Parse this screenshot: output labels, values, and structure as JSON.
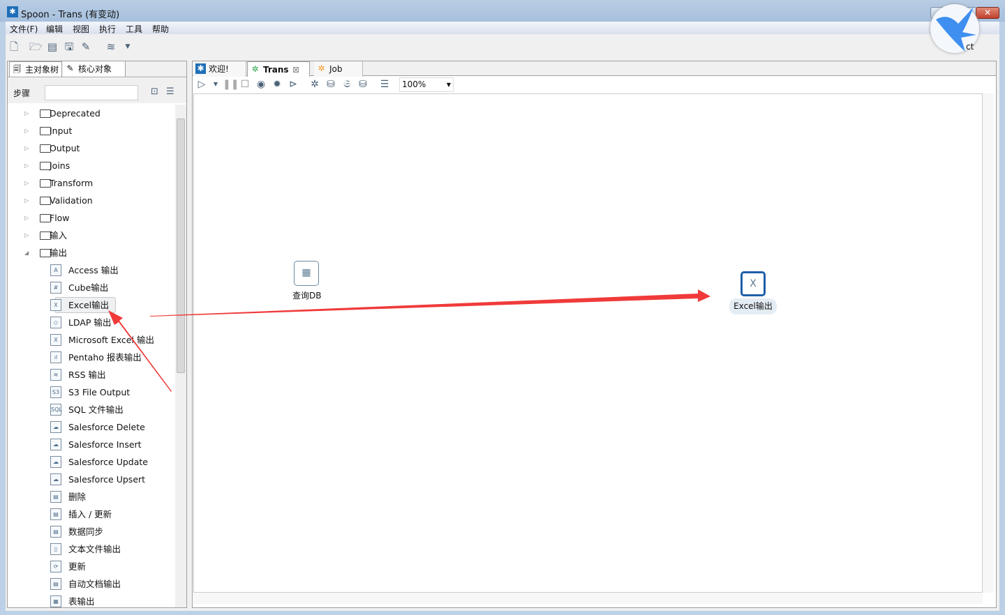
{
  "window": {
    "title": "Spoon - Trans (有变动)",
    "partial_label": "ct"
  },
  "menu": [
    "文件(F)",
    "编辑",
    "视图",
    "执行",
    "工具",
    "帮助"
  ],
  "left_panel": {
    "tabs": [
      "主对象树",
      "核心对象"
    ],
    "search_label": "步骤",
    "search_value": "",
    "folders": [
      "Deprecated",
      "Input",
      "Output",
      "Joins",
      "Transform",
      "Validation",
      "Flow",
      "输入"
    ],
    "expanded_folder": "输出",
    "steps": [
      {
        "label": "Access 输出",
        "icon": "A"
      },
      {
        "label": "Cube输出",
        "icon": "#"
      },
      {
        "label": "Excel输出",
        "icon": "X"
      },
      {
        "label": "LDAP 输出",
        "icon": "◇"
      },
      {
        "label": "Microsoft Excel 输出",
        "icon": "X"
      },
      {
        "label": "Pentaho 报表输出",
        "icon": "ıl"
      },
      {
        "label": "RSS 输出",
        "icon": "≋"
      },
      {
        "label": "S3 File Output",
        "icon": "S3"
      },
      {
        "label": "SQL 文件输出",
        "icon": "SQL"
      },
      {
        "label": "Salesforce Delete",
        "icon": "☁"
      },
      {
        "label": "Salesforce Insert",
        "icon": "☁"
      },
      {
        "label": "Salesforce Update",
        "icon": "☁"
      },
      {
        "label": "Salesforce Upsert",
        "icon": "☁"
      },
      {
        "label": "删除",
        "icon": "▤"
      },
      {
        "label": "插入 / 更新",
        "icon": "▤"
      },
      {
        "label": "数据同步",
        "icon": "▤"
      },
      {
        "label": "文本文件输出",
        "icon": "▯"
      },
      {
        "label": "更新",
        "icon": "⟳"
      },
      {
        "label": "自动文档输出",
        "icon": "▤"
      },
      {
        "label": "表输出",
        "icon": "▦"
      }
    ],
    "selected_step": "Excel输出"
  },
  "editor": {
    "tabs": [
      {
        "label": "欢迎!",
        "icon": "spoon-icon"
      },
      {
        "label": "Trans",
        "icon": "trans-icon",
        "active": true
      },
      {
        "label": "Job",
        "icon": "job-icon"
      }
    ],
    "zoom": "100%",
    "nodes": [
      {
        "label": "查询DB",
        "icon": "table-input-icon"
      },
      {
        "label": "Excel输出",
        "icon": "excel-output-icon",
        "selected": true
      }
    ]
  },
  "colors": {
    "annotation_arrow": "#f03a3a",
    "selection": "#1f5fa8"
  }
}
